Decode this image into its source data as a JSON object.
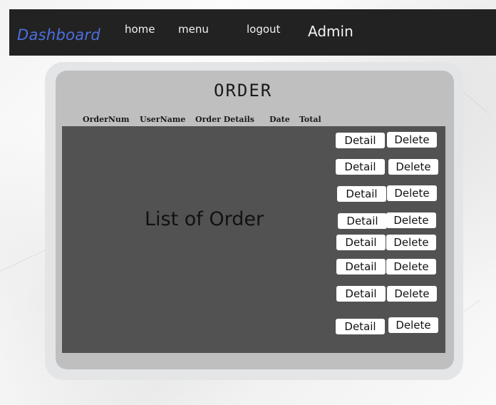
{
  "navbar": {
    "brand": "Dashboard",
    "links": [
      "home",
      "menu",
      "logout"
    ],
    "user": "Admin"
  },
  "panel": {
    "title": "ORDER",
    "columns": [
      "OrderNum",
      "UserName",
      "Order Details",
      "Date",
      "Total"
    ],
    "list_placeholder": "List of Order"
  },
  "rows": [
    {
      "detail": "Detail",
      "delete": "Delete"
    },
    {
      "detail": "Detail",
      "delete": "Delete"
    },
    {
      "detail": "Detail",
      "delete": "Delete"
    },
    {
      "detail": "Detail",
      "delete": "Delete"
    },
    {
      "detail": "Detail",
      "delete": "Delete"
    },
    {
      "detail": "Detail",
      "delete": "Delete"
    },
    {
      "detail": "Detail",
      "delete": "Delete"
    },
    {
      "detail": "Detail",
      "delete": "Delete"
    }
  ],
  "colors": {
    "navbar_bg": "#222222",
    "brand": "#4d6fe0",
    "list_bg": "#525252",
    "panel_bg": "#bfbfbf"
  }
}
